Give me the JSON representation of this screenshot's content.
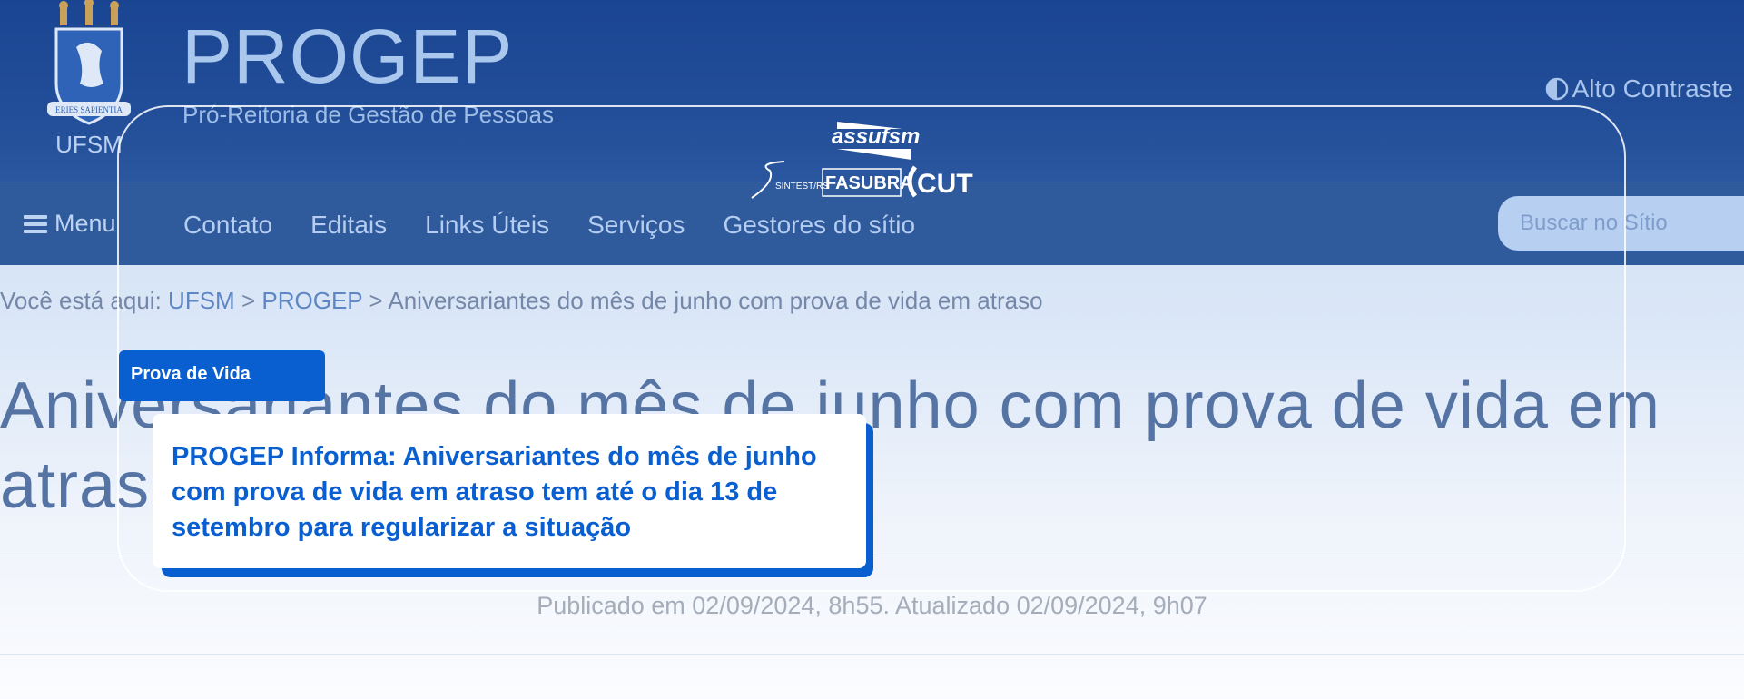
{
  "header": {
    "logo_text": "UFSM",
    "title": "PROGEP",
    "subtitle": "Pró-Reitoria de Gestão de Pessoas",
    "contrast_label": "Alto Contraste"
  },
  "nav": {
    "menu_label": "Menu",
    "links": [
      "Contato",
      "Editais",
      "Links Úteis",
      "Serviços",
      "Gestores do sítio"
    ],
    "search_placeholder": "Buscar no Sítio"
  },
  "breadcrumb": {
    "prefix": "Você está aqui:",
    "items": [
      "UFSM",
      "PROGEP"
    ],
    "separator": ">",
    "current": "Aniversariantes do mês de junho com prova de vida em atraso"
  },
  "page": {
    "title": "Aniversariantes do mês de junho com prova de vida em atraso",
    "published": "Publicado em 02/09/2024, 8h55. Atualizado 02/09/2024, 9h07"
  },
  "overlay": {
    "union_logos": {
      "assufsm": "assufsm",
      "sintest": "SINTEST/RS",
      "fasubra": "FASUBRA",
      "cut": "CUT"
    },
    "tag": "Prova de Vida",
    "card_title": "PROGEP Informa: Aniversariantes do mês de junho com prova de vida em atraso tem até o dia 13 de setembro para regularizar a situação"
  },
  "colors": {
    "header_bg": "#1a4592",
    "nav_bg": "#2f5a9c",
    "accent": "#0a5fd0"
  }
}
